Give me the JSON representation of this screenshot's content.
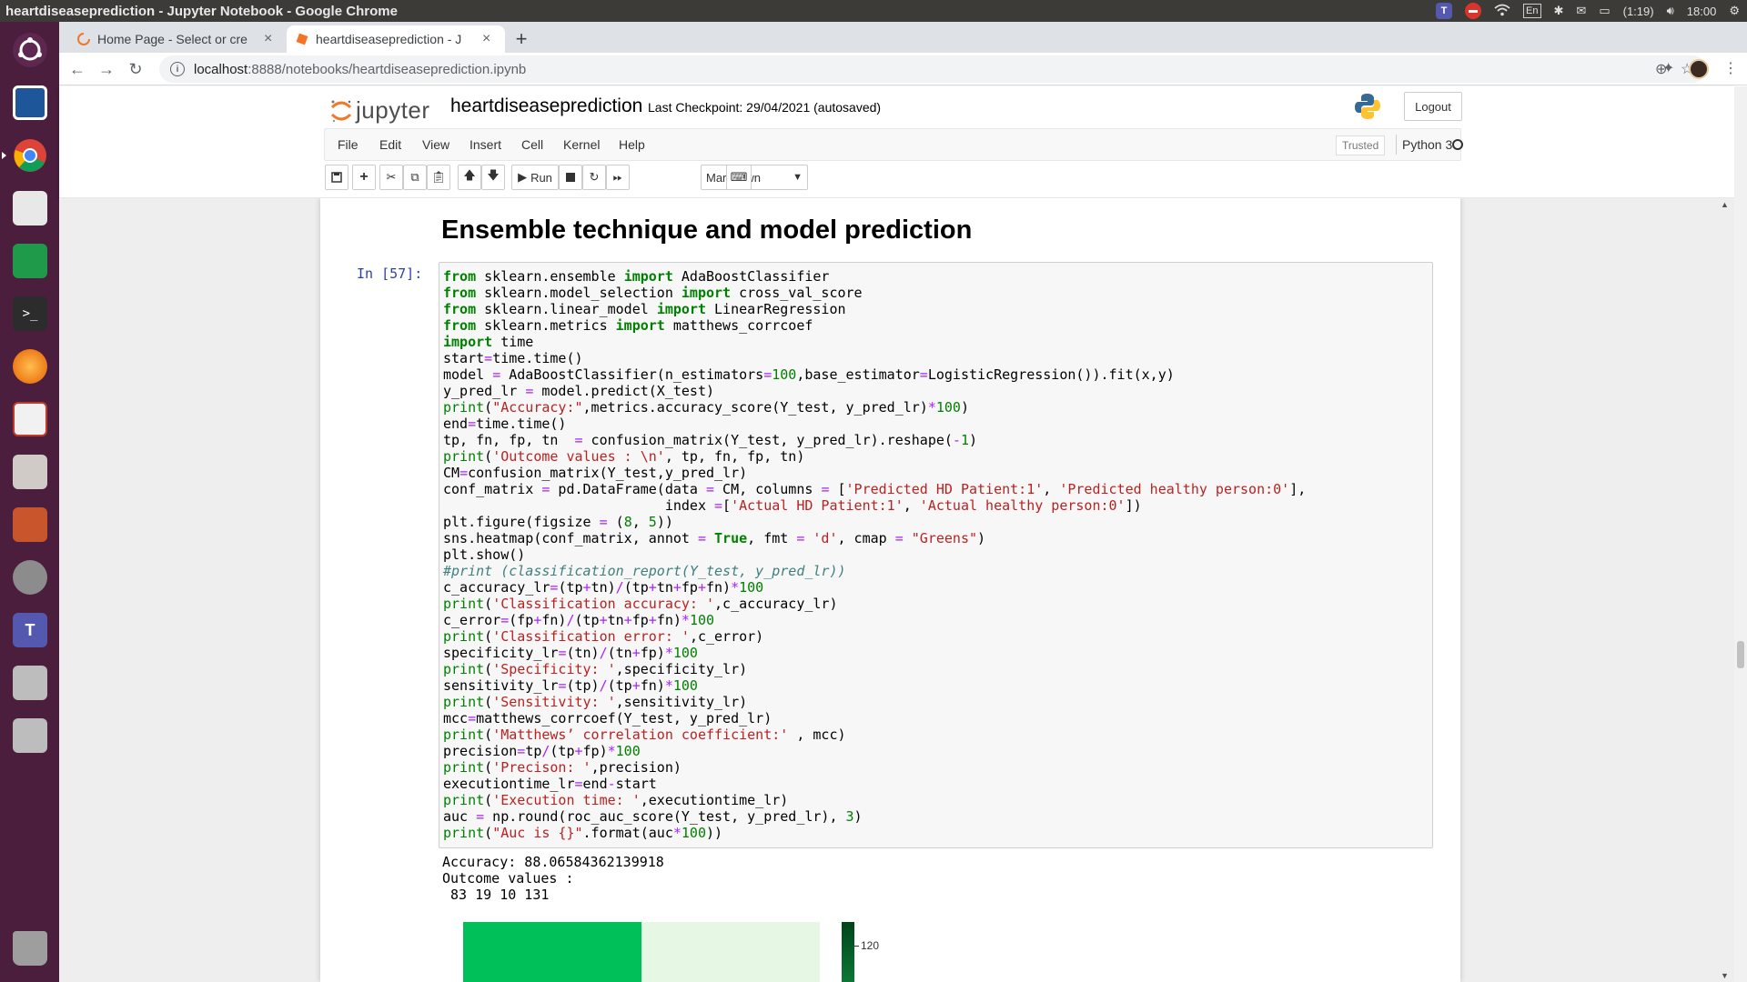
{
  "window_title": "heartdiseaseprediction - Jupyter Notebook - Google Chrome",
  "tray": {
    "input_lang": "En",
    "battery": "(1:19)",
    "clock": "18:00"
  },
  "tabs": [
    {
      "label": "Home Page - Select or cre",
      "close": "×"
    },
    {
      "label": "heartdiseaseprediction - J",
      "close": "×"
    }
  ],
  "newtab": "+",
  "url": {
    "host": "localhost",
    "rest": ":8888/notebooks/heartdiseaseprediction.ipynb"
  },
  "jupyter": {
    "logo_text": "jupyter",
    "notebook_name": "heartdiseaseprediction",
    "checkpoint": "Last Checkpoint: 29/04/2021   (autosaved)",
    "logout": "Logout",
    "menu": [
      "File",
      "Edit",
      "View",
      "Insert",
      "Cell",
      "Kernel",
      "Help"
    ],
    "trusted": "Trusted",
    "kernel": "Python 3",
    "run_label": "Run",
    "cell_type": "Markdown"
  },
  "cell": {
    "heading": "Ensemble technique and model prediction",
    "prompt": "In [57]:",
    "output_lines": [
      "Accuracy: 88.06584362139918",
      "Outcome values :",
      " 83 19 10 131"
    ]
  },
  "heatmap": {
    "colorbar_tick": "120",
    "colors": [
      "#00c05a",
      "#e6f7e3"
    ]
  }
}
